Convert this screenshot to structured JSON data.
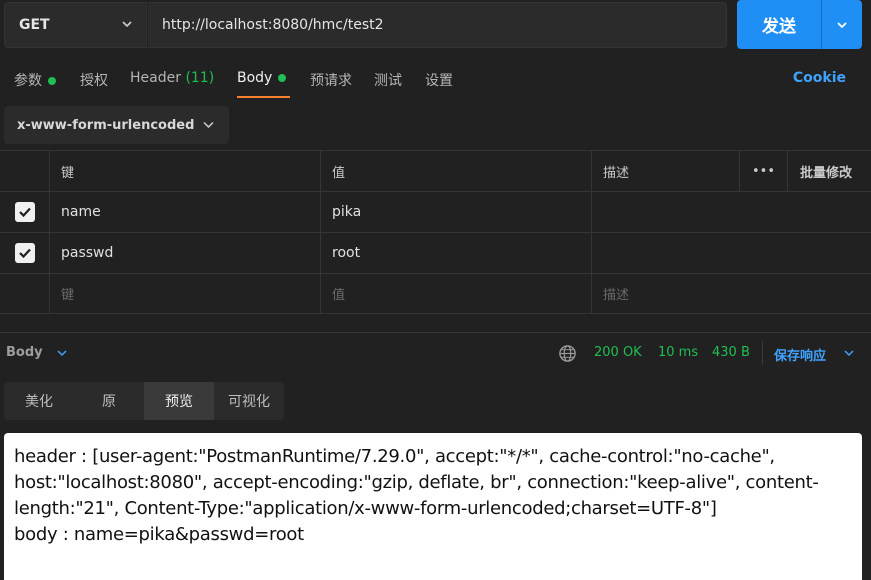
{
  "request": {
    "method": "GET",
    "url": "http://localhost:8080/hmc/test2",
    "send_label": "发送"
  },
  "tabs": [
    {
      "label": "参数",
      "dot": true
    },
    {
      "label": "授权"
    },
    {
      "label": "Header",
      "count": "(11)"
    },
    {
      "label": "Body",
      "dot": true,
      "active": true
    },
    {
      "label": "预请求"
    },
    {
      "label": "测试"
    },
    {
      "label": "设置"
    }
  ],
  "cookie_label": "Cookie",
  "body_type": "x-www-form-urlencoded",
  "table": {
    "headers": {
      "key": "键",
      "value": "值",
      "description": "描述",
      "more": "•••",
      "bulk_edit": "批量修改"
    },
    "rows": [
      {
        "checked": true,
        "key": "name",
        "value": "pika",
        "description": ""
      },
      {
        "checked": true,
        "key": "passwd",
        "value": "root",
        "description": ""
      }
    ],
    "placeholder": {
      "key": "键",
      "value": "值",
      "description": "描述"
    }
  },
  "response": {
    "label": "Body",
    "status": "200 OK",
    "time": "10 ms",
    "size": "430 B",
    "save_label": "保存响应",
    "views": [
      "美化",
      "原",
      "预览",
      "可视化"
    ],
    "active_view": "预览",
    "preview_lines": [
      "header : [user-agent:\"PostmanRuntime/7.29.0\", accept:\"*/*\", cache-control:\"no-cache\", host:\"localhost:8080\", accept-encoding:\"gzip, deflate, br\", connection:\"keep-alive\", content-length:\"21\", Content-Type:\"application/x-www-form-urlencoded;charset=UTF-8\"]",
      "body : name=pika&passwd=root"
    ]
  },
  "colors": {
    "accent": "#1f8ff5",
    "status_green": "#1fbf52",
    "active_tab_underline": "#f47f2c",
    "link_blue": "#3fa2ff"
  }
}
